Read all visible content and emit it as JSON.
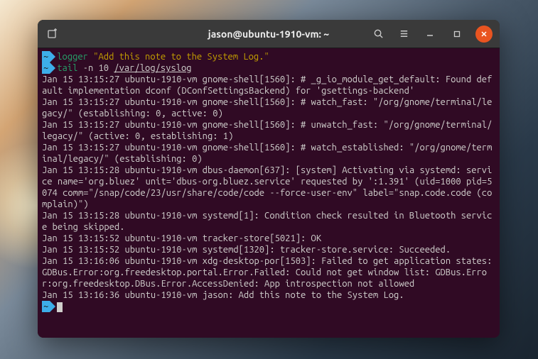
{
  "window": {
    "title": "jason@ubuntu-1910-vm: ~"
  },
  "prompt": {
    "symbol": "~"
  },
  "commands": {
    "line1": {
      "cmd": "logger",
      "arg": "\"Add this note to the System Log.\""
    },
    "line2": {
      "cmd": "tail",
      "flag": "-n 10",
      "path": "/var/log/syslog"
    }
  },
  "output_lines": [
    "Jan 15 13:15:27 ubuntu-1910-vm gnome-shell[1560]: # _g_io_module_get_default: Found default implementation dconf (DConfSettingsBackend) for 'gsettings-backend'",
    "Jan 15 13:15:27 ubuntu-1910-vm gnome-shell[1560]: # watch_fast: \"/org/gnome/terminal/legacy/\" (establishing: 0, active: 0)",
    "Jan 15 13:15:27 ubuntu-1910-vm gnome-shell[1560]: # unwatch_fast: \"/org/gnome/terminal/legacy/\" (active: 0, establishing: 1)",
    "Jan 15 13:15:27 ubuntu-1910-vm gnome-shell[1560]: # watch_established: \"/org/gnome/terminal/legacy/\" (establishing: 0)",
    "Jan 15 13:15:28 ubuntu-1910-vm dbus-daemon[637]: [system] Activating via systemd: service name='org.bluez' unit='dbus-org.bluez.service' requested by ':1.391' (uid=1000 pid=5074 comm=\"/snap/code/23/usr/share/code/code --force-user-env\" label=\"snap.code.code (complain)\")",
    "Jan 15 13:15:28 ubuntu-1910-vm systemd[1]: Condition check resulted in Bluetooth service being skipped.",
    "Jan 15 13:15:52 ubuntu-1910-vm tracker-store[5021]: OK",
    "Jan 15 13:15:52 ubuntu-1910-vm systemd[1320]: tracker-store.service: Succeeded.",
    "Jan 15 13:16:06 ubuntu-1910-vm xdg-desktop-por[1503]: Failed to get application states: GDBus.Error:org.freedesktop.portal.Error.Failed: Could not get window list: GDBus.Error:org.freedesktop.DBus.Error.AccessDenied: App introspection not allowed",
    "Jan 15 13:16:36 ubuntu-1910-vm jason: Add this note to the System Log."
  ]
}
